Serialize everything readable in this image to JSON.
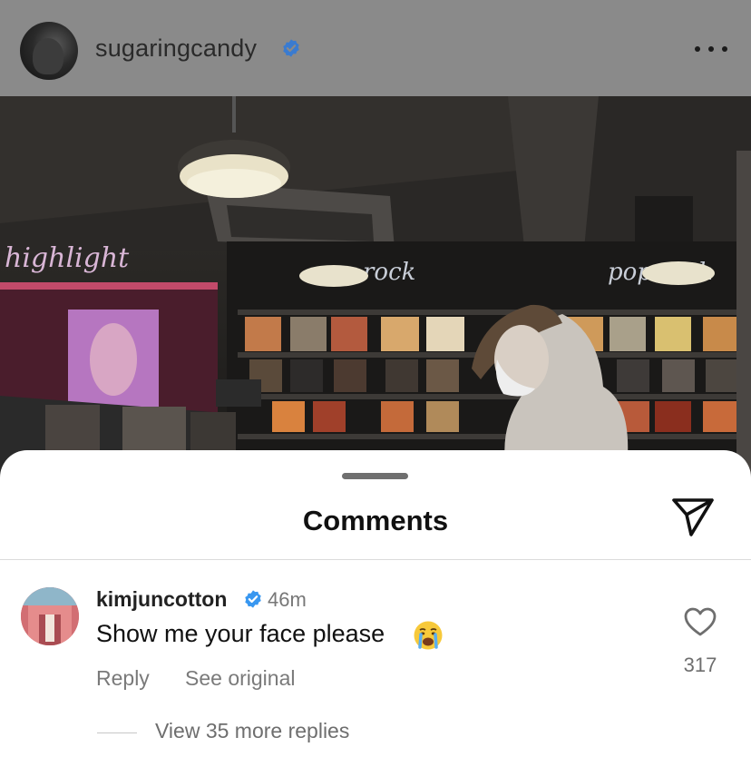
{
  "post": {
    "username": "sugaringcandy",
    "verified": true,
    "more_icon": "more-horizontal-icon",
    "photo_signs": [
      "highlight",
      "rock",
      "pop rock"
    ]
  },
  "comments_sheet": {
    "title": "Comments",
    "share_icon": "send-icon",
    "comment": {
      "username": "kimjuncotton",
      "verified": true,
      "time": "46m",
      "text": "Show me your face please",
      "emoji": "crying-face",
      "reply_label": "Reply",
      "see_original_label": "See original",
      "likes": "317",
      "like_icon": "heart-icon",
      "view_replies_label": "View 35 more replies"
    }
  },
  "colors": {
    "verified_blue": "#3897f0",
    "header_overlay": "#8a8a8a",
    "muted_text": "#7a7a7a"
  }
}
